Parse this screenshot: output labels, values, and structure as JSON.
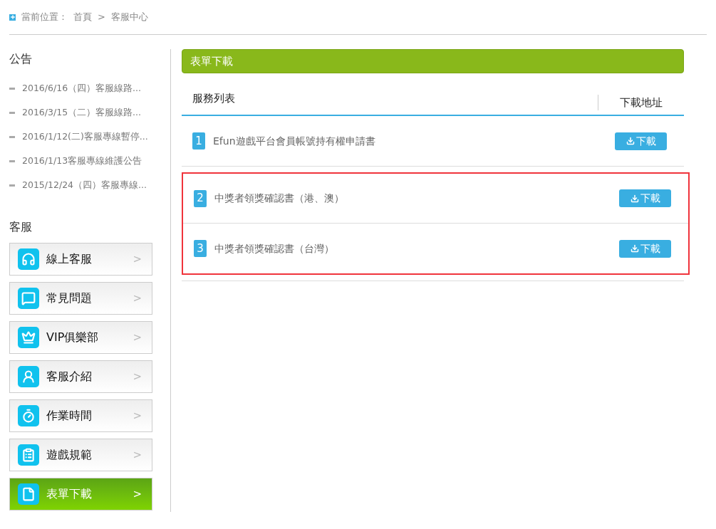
{
  "breadcrumb": {
    "label": "當前位置：",
    "items": [
      "首頁",
      "客服中心"
    ],
    "separator": ">"
  },
  "notices": {
    "title": "公告",
    "items": [
      "2016/6/16（四）客服線路...",
      "2016/3/15（二）客服線路...",
      "2016/1/12(二)客服專線暫停...",
      "2016/1/13客服專線維護公告",
      "2015/12/24（四）客服專線..."
    ]
  },
  "service_menu": {
    "title": "客服",
    "items": [
      {
        "label": "線上客服",
        "selected": false
      },
      {
        "label": "常見問題",
        "selected": false
      },
      {
        "label": "VIP俱樂部",
        "selected": false
      },
      {
        "label": "客服介紹",
        "selected": false
      },
      {
        "label": "作業時間",
        "selected": false
      },
      {
        "label": "遊戲規範",
        "selected": false
      },
      {
        "label": "表單下載",
        "selected": true
      }
    ],
    "arrow": ">"
  },
  "panel": {
    "title": "表單下載",
    "columns": [
      "服務列表",
      "下載地址"
    ],
    "rows": [
      {
        "number": "1",
        "name": "Efun遊戲平台會員帳號持有權申請書",
        "button": "下載",
        "highlighted": false
      },
      {
        "number": "2",
        "name": "中獎者領獎確認書（港、澳）",
        "button": "下載",
        "highlighted": true
      },
      {
        "number": "3",
        "name": "中獎者領獎確認書（台灣）",
        "button": "下載",
        "highlighted": true
      }
    ]
  }
}
